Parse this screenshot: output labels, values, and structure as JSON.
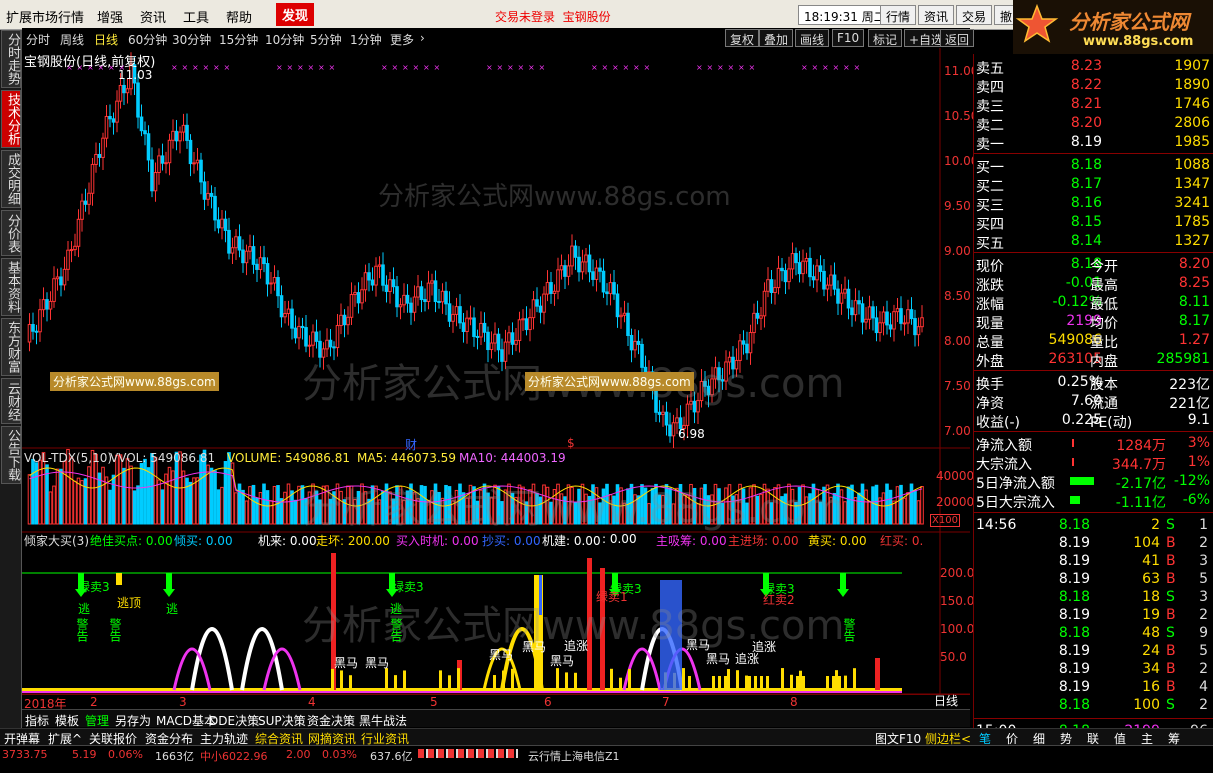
{
  "menu": {
    "items": [
      "扩展市场行情",
      "增强",
      "资讯",
      "工具",
      "帮助",
      "发现"
    ],
    "alert1": "交易未登录",
    "alert2": "宝钢股份",
    "time": "18:19:31",
    "weekday": "周二",
    "right_buttons": [
      "行情",
      "资讯",
      "交易",
      "撤"
    ]
  },
  "logo": {
    "text": "分析家公式网",
    "url": "www.88gs.com"
  },
  "vtabs": [
    "分时走势",
    "技术分析",
    "成交明细",
    "分价表",
    "基本资料",
    "东方财富",
    "云财经",
    "公告下载"
  ],
  "periods": [
    "分时",
    "周线",
    "日线",
    "60分钟",
    "30分钟",
    "15分钟",
    "10分钟",
    "5分钟",
    "1分钟",
    "更多"
  ],
  "period_arrow": "›",
  "toolbar": [
    "复权",
    "叠加",
    "画线",
    "F10",
    "标记",
    "+自选",
    "返回"
  ],
  "chart": {
    "title": "宝钢股份(日线,前复权)",
    "high_label": "11.03",
    "low_label": "6.98",
    "price_axis": [
      "11.00",
      "10.50",
      "10.00",
      "9.50",
      "9.00",
      "8.50",
      "8.00",
      "7.50",
      "7.00"
    ],
    "vol_axis": [
      "40000",
      "20000",
      "X100"
    ],
    "ind_axis": [
      "200.0",
      "150.0",
      "100.0",
      "50.0"
    ],
    "vol_title": "VOL-TDX(5,10)",
    "vvol": "VVOL: 549086.81",
    "volume": "VOLUME: 549086.81",
    "ma5": "MA5: 446073.59",
    "ma10": "MA10: 444003.19",
    "ind_title": "倾家大买(3)",
    "ind_items": [
      "绝佳买点: 0.00",
      "倾买: 0.00",
      "机来: 0.00",
      "走坏: 200.00",
      "买入时机: 0.00",
      "抄买: 0.00",
      "机建: 0.00",
      ": 0.00",
      "主吸筹: 0.00",
      "主进场: 0.00",
      "黄买: 0.00",
      "红买: 0."
    ],
    "signals": [
      "绿卖3",
      "逃顶",
      "逃",
      "警告",
      "警告",
      "逃",
      "绿卖3",
      "逃",
      "警告",
      "黑马",
      "黑马",
      "追涨",
      "黑马",
      "黑马",
      "黑马",
      "追涨",
      "绿卖3",
      "绿卖1",
      "绿卖3",
      "红卖2",
      "警告",
      "黑马",
      "黑马",
      "追涨"
    ],
    "month_labels": [
      "2018年",
      "2",
      "3",
      "4",
      "5",
      "6",
      "7",
      "8"
    ],
    "period_label": "日线",
    "zoom": [
      "+",
      "-",
      "0"
    ],
    "markers": [
      "财",
      "$"
    ],
    "watermark": "分析家公式网www.88gs.com",
    "watermark_small": "分析家公式网www.88gs.com"
  },
  "quote": {
    "asks": [
      [
        "卖五",
        "8.23",
        "1907"
      ],
      [
        "卖四",
        "8.22",
        "1890"
      ],
      [
        "卖三",
        "8.21",
        "1746"
      ],
      [
        "卖二",
        "8.20",
        "2806"
      ],
      [
        "卖一",
        "8.19",
        "1985"
      ]
    ],
    "bids": [
      [
        "买一",
        "8.18",
        "1088"
      ],
      [
        "买二",
        "8.17",
        "1347"
      ],
      [
        "买三",
        "8.16",
        "3241"
      ],
      [
        "买四",
        "8.15",
        "1785"
      ],
      [
        "买五",
        "8.14",
        "1327"
      ]
    ],
    "stats": [
      [
        "现价",
        "8.18",
        "今开",
        "8.20"
      ],
      [
        "涨跌",
        "-0.01",
        "最高",
        "8.25"
      ],
      [
        "涨幅",
        "-0.12%",
        "最低",
        "8.11"
      ],
      [
        "现量",
        "2199",
        "均价",
        "8.17"
      ],
      [
        "总量",
        "549086",
        "量比",
        "1.27"
      ],
      [
        "外盘",
        "263105",
        "内盘",
        "285981"
      ]
    ],
    "fund": [
      [
        "换手",
        "0.25%",
        "股本",
        "223亿"
      ],
      [
        "净资",
        "7.60",
        "流通",
        "221亿"
      ],
      [
        "收益(-)",
        "0.225",
        "PE(动)",
        "9.1"
      ]
    ],
    "flows": [
      [
        "净流入额",
        "1284万",
        "3%"
      ],
      [
        "大宗流入",
        "344.7万",
        "1%"
      ],
      [
        "5日净流入额",
        "-2.17亿",
        "-12%"
      ],
      [
        "5日大宗流入",
        "-1.11亿",
        "-6%"
      ]
    ],
    "ticks": [
      [
        "14:56",
        "8.18",
        "2",
        "S",
        "1"
      ],
      [
        "",
        "8.19",
        "104",
        "B",
        "2"
      ],
      [
        "",
        "8.19",
        "41",
        "B",
        "3"
      ],
      [
        "",
        "8.19",
        "63",
        "B",
        "5"
      ],
      [
        "",
        "8.18",
        "18",
        "S",
        "3"
      ],
      [
        "",
        "8.19",
        "19",
        "B",
        "2"
      ],
      [
        "",
        "8.18",
        "48",
        "S",
        "9"
      ],
      [
        "",
        "8.19",
        "24",
        "B",
        "5"
      ],
      [
        "",
        "8.19",
        "34",
        "B",
        "2"
      ],
      [
        "",
        "8.19",
        "16",
        "B",
        "4"
      ],
      [
        "",
        "8.18",
        "100",
        "S",
        "2"
      ]
    ],
    "last": [
      "15:00",
      "8.18",
      "2199",
      "96"
    ]
  },
  "bottom_tabs": [
    "指标",
    "模板",
    "管理",
    "另存为",
    "MACD基本",
    "DDE决策",
    "SUP决策",
    "资金决策",
    "黑牛战法"
  ],
  "bottom2": [
    "开弹幕",
    "扩展^",
    "关联报价",
    "资金分布",
    "主力轨迹",
    "综合资讯",
    "网摘资讯",
    "行业资讯"
  ],
  "bottom2_right": [
    "图文F10",
    "侧边栏<"
  ],
  "side_tabs": [
    "笔",
    "价",
    "细",
    "势",
    "联",
    "值",
    "主",
    "筹"
  ],
  "status": {
    "index": "3733.75",
    "chg": "5.19",
    "pct": "0.06%",
    "amt": "1663亿",
    "zx": "中小6022.96",
    "chg2": "2.00",
    "pct2": "0.03%",
    "amt2": "637.6亿",
    "cloud": "云行情上海电信Z1"
  }
}
